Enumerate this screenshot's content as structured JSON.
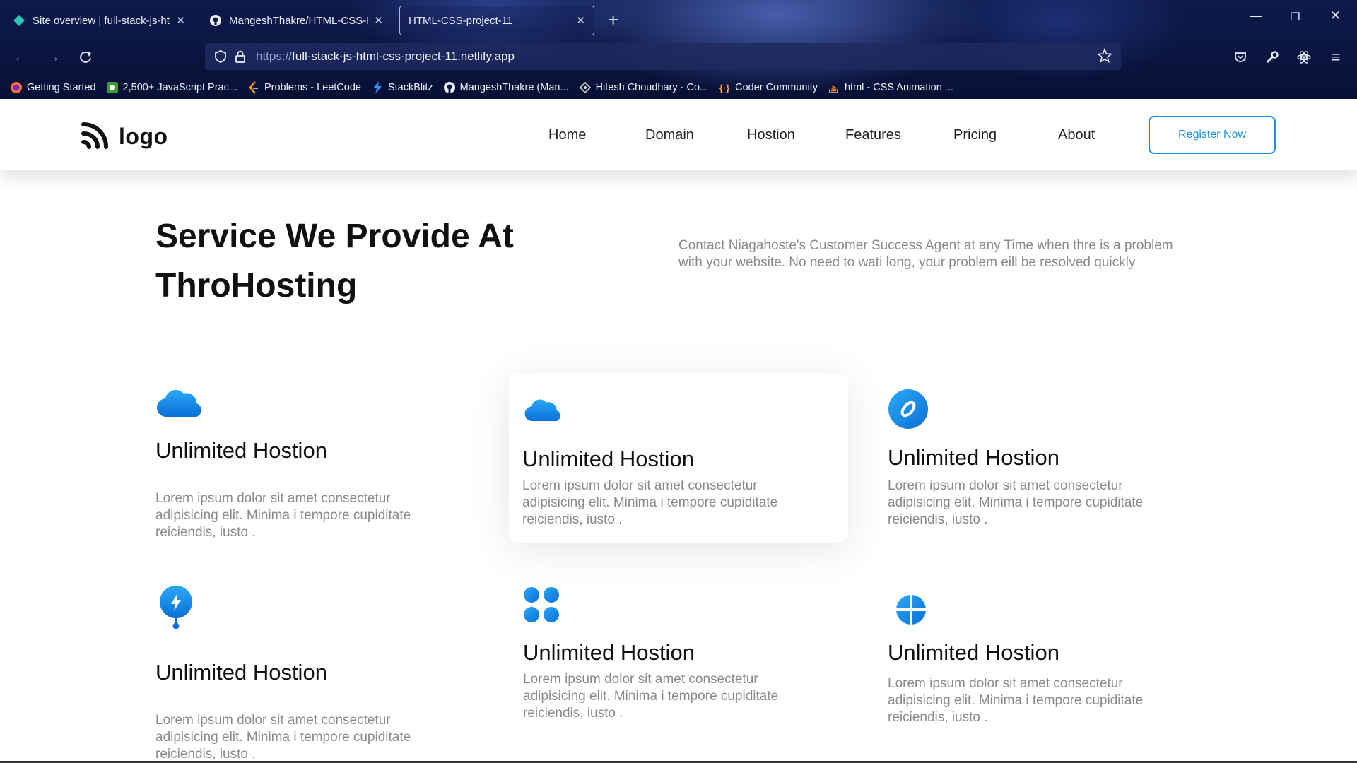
{
  "browser": {
    "tabs": [
      {
        "title": "Site overview | full-stack-js-html",
        "icon": "netlify-icon",
        "active": false
      },
      {
        "title": "MangeshThakre/HTML-CSS-Proj",
        "icon": "github-icon",
        "active": false
      },
      {
        "title": "HTML-CSS-project-11",
        "icon": "",
        "active": true
      }
    ],
    "new_tab": "+",
    "url_protocol": "https://",
    "url_host": "full-stack-js-html-css-project-11.netlify.app",
    "bookmarks": [
      {
        "label": "Getting Started",
        "icon": "firefox-icon"
      },
      {
        "label": "2,500+ JavaScript Prac...",
        "icon": "w3resource-icon"
      },
      {
        "label": "Problems - LeetCode",
        "icon": "leetcode-icon"
      },
      {
        "label": "StackBlitz",
        "icon": "stackblitz-icon"
      },
      {
        "label": "MangeshThakre (Man...",
        "icon": "github-icon"
      },
      {
        "label": "Hitesh Choudhary - Co...",
        "icon": "hitesh-icon"
      },
      {
        "label": "Coder Community",
        "icon": "code-icon"
      },
      {
        "label": "html - CSS Animation ...",
        "icon": "stackoverflow-icon"
      }
    ]
  },
  "site": {
    "logo_text": "logo",
    "nav": [
      "Home",
      "Domain",
      "Hostion",
      "Features",
      "Pricing",
      "About"
    ],
    "register_label": "Register Now",
    "hero_title": "Service We Provide At ThroHosting",
    "hero_desc": "Contact Niagahoste's Customer Success Agent at any Time when thre is a problem with your website. No need to wati long, your problem eill be resolved quickly",
    "accent_color": "#1e8fe0",
    "cards": [
      {
        "icon": "cloud-icon",
        "title": "Unlimited Hostion",
        "text": "Lorem ipsum dolor sit amet consectetur adipisicing elit. Minima i tempore cupiditate reiciendis, iusto ."
      },
      {
        "icon": "cloud-icon",
        "title": "Unlimited Hostion",
        "text": "Lorem ipsum dolor sit amet consectetur adipisicing elit. Minima i tempore cupiditate reiciendis, iusto ."
      },
      {
        "icon": "rocket-circle-icon",
        "title": "Unlimited Hostion",
        "text": "Lorem ipsum dolor sit amet consectetur adipisicing elit. Minima i tempore cupiditate reiciendis, iusto ."
      },
      {
        "icon": "lightning-pin-icon",
        "title": "Unlimited Hostion",
        "text": "Lorem ipsum dolor sit amet consectetur adipisicing elit. Minima i tempore cupiditate reiciendis, iusto ."
      },
      {
        "icon": "grid-dots-icon",
        "title": "Unlimited Hostion",
        "text": "Lorem ipsum dolor sit amet consectetur adipisicing elit. Minima i tempore cupiditate reiciendis, iusto ."
      },
      {
        "icon": "pie-chart-icon",
        "title": "Unlimited Hostion",
        "text": "Lorem ipsum dolor sit amet consectetur adipisicing elit. Minima i tempore cupiditate reiciendis, iusto ."
      }
    ]
  }
}
